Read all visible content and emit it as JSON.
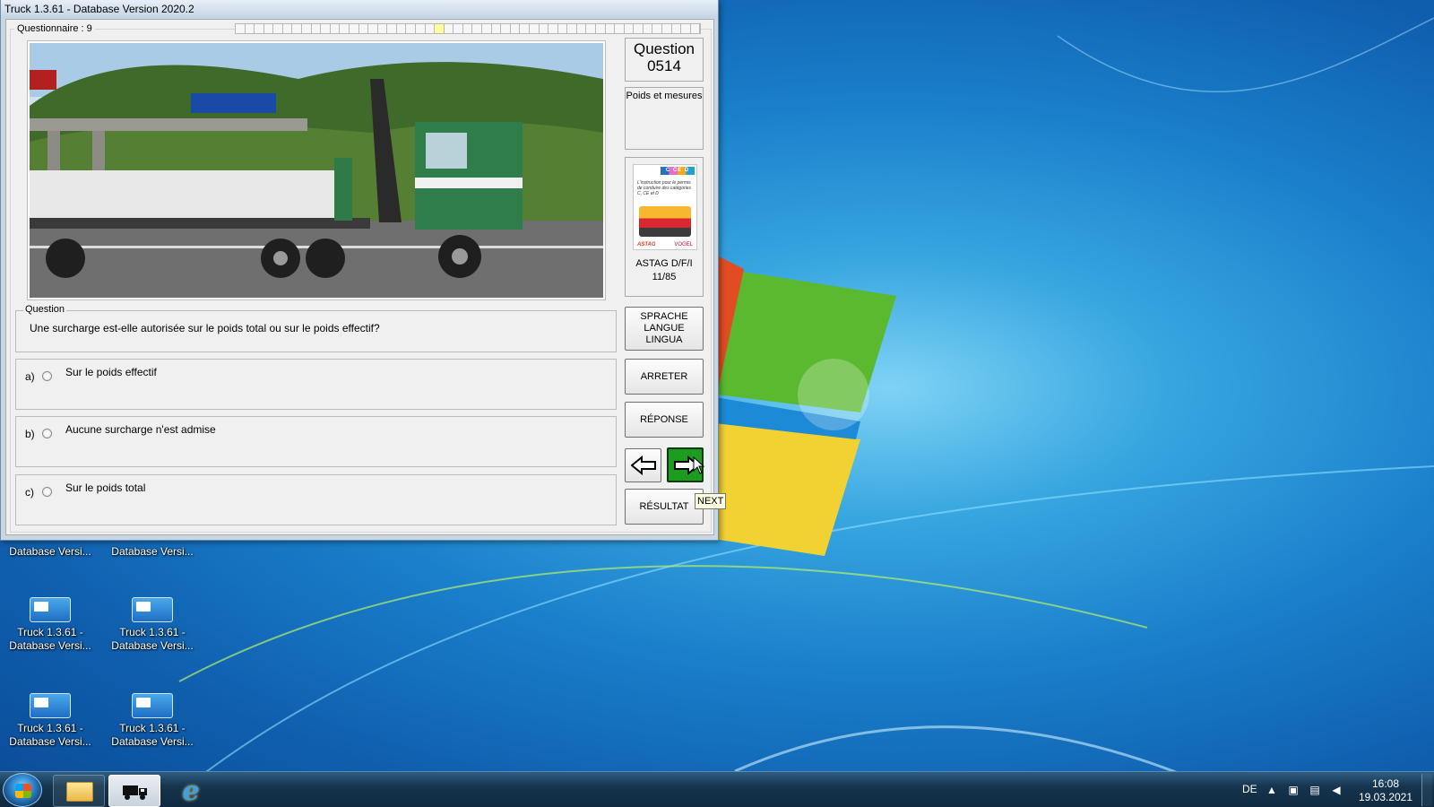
{
  "window": {
    "title": "Truck 1.3.61 - Database Version 2020.2",
    "questionnaire_label": "Questionnaire : 9",
    "progress": {
      "segments": 49,
      "current_index": 21
    }
  },
  "question_panel": {
    "number_title": "Question",
    "number": "0514",
    "category": "Poids et mesures",
    "book": {
      "cover_categories": "C CE D DE",
      "cover_title": "L'instruction pour le permis de conduire des catégories C, CE et D",
      "cover_logo_left": "ASTAG",
      "cover_logo_right": "VOGEL",
      "label_line1": "ASTAG D/F/I",
      "label_line2": "11/85"
    }
  },
  "question": {
    "legend": "Question",
    "text": "Une surcharge est-elle autorisée sur le poids total ou sur le poids effectif?"
  },
  "answers": [
    {
      "letter": "a)",
      "text": "Sur le poids effectif"
    },
    {
      "letter": "b)",
      "text": "Aucune surcharge n'est admise"
    },
    {
      "letter": "c)",
      "text": "Sur le poids total"
    }
  ],
  "buttons": {
    "language": [
      "SPRACHE",
      "LANGUE",
      "LINGUA"
    ],
    "stop": "ARRETER",
    "answer": "RÉPONSE",
    "result": "RÉSULTAT",
    "previous_icon": "arrow-left-icon",
    "next_icon": "arrow-right-icon",
    "next_tooltip": "NEXT"
  },
  "desktop_icons": [
    {
      "line1": "",
      "line2": "Database Versi..."
    },
    {
      "line1": "",
      "line2": "Database Versi..."
    },
    {
      "line1": "Truck 1.3.61 -",
      "line2": "Database Versi..."
    },
    {
      "line1": "Truck 1.3.61 -",
      "line2": "Database Versi..."
    },
    {
      "line1": "Truck 1.3.61 -",
      "line2": "Database Versi..."
    },
    {
      "line1": "Truck 1.3.61 -",
      "line2": "Database Versi..."
    }
  ],
  "taskbar": {
    "language": "DE",
    "time": "16:08",
    "date": "19.03.2021",
    "colors": {
      "next_button": "#1d9c21",
      "taskbar": "#16354f"
    }
  }
}
